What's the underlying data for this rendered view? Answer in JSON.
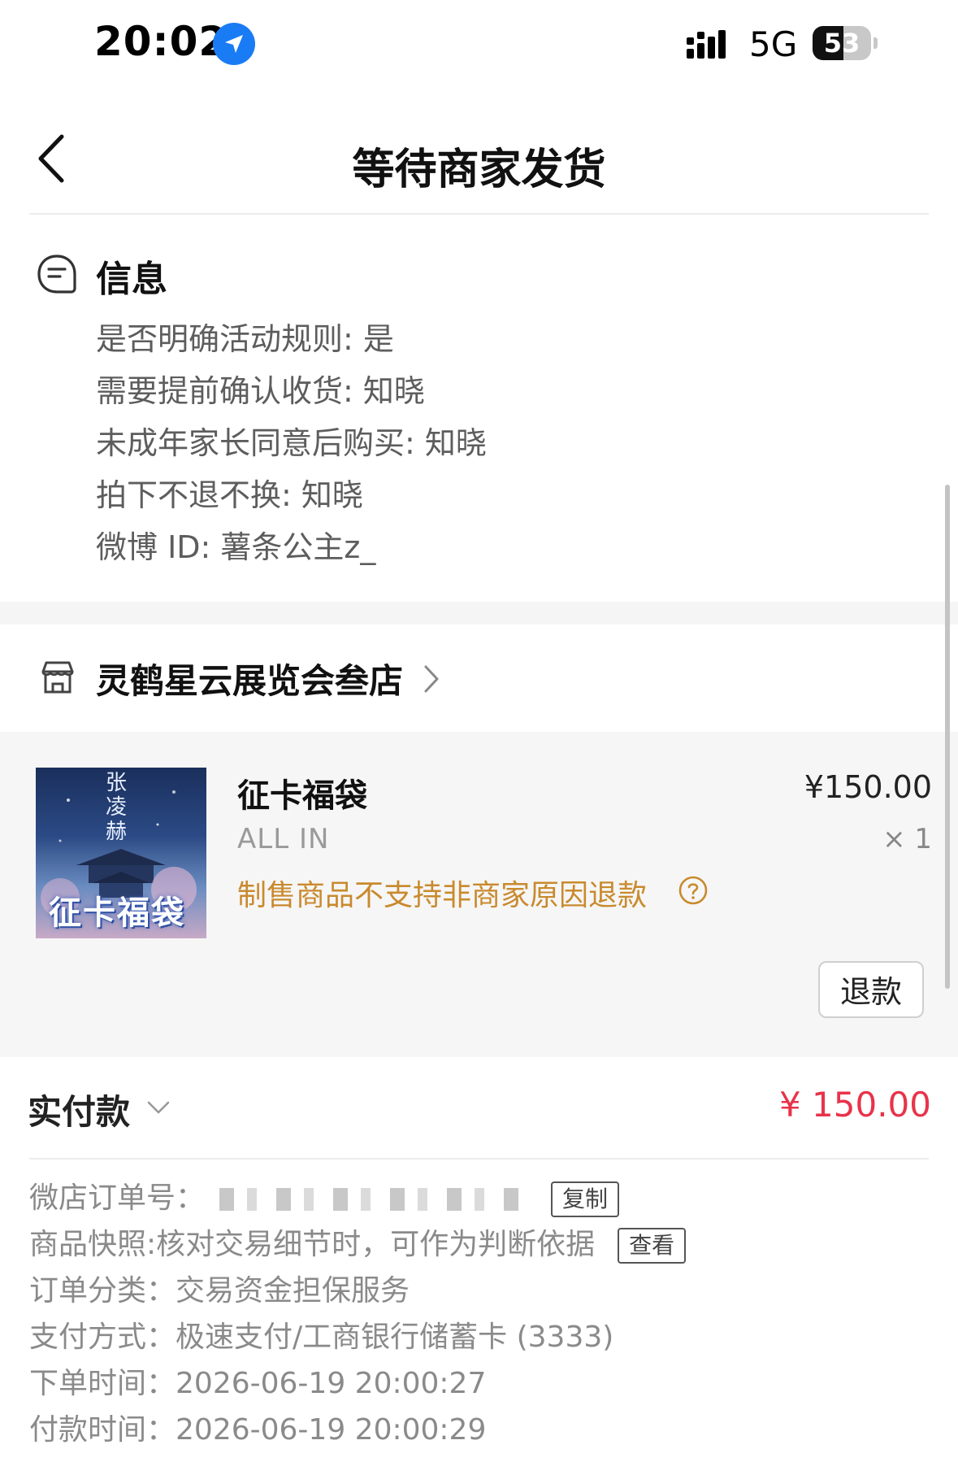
{
  "status_bar": {
    "time": "20:02",
    "network": "5G",
    "battery": "53",
    "battery_level_percent": 53
  },
  "nav": {
    "title": "等待商家发货"
  },
  "info": {
    "title": "信息",
    "lines": [
      "是否明确活动规则: 是",
      "需要提前确认收货: 知晓",
      "未成年家长同意后购买: 知晓",
      "拍下不退不换: 知晓",
      "微博 ID: 薯条公主z_"
    ]
  },
  "shop": {
    "name": "灵鹤星云展览会叁店"
  },
  "product": {
    "image_text_top": "张凌赫",
    "image_text_main": "征卡福袋",
    "name": "征卡福袋",
    "variant": "ALL IN",
    "refund_policy": "制售商品不支持非商家原因退款",
    "price": "¥150.00",
    "quantity": "× 1",
    "refund_button": "退款"
  },
  "payment": {
    "label": "实付款",
    "amount": "¥ 150.00",
    "amount_color": "#e8334a"
  },
  "details": {
    "order_no_label": "微店订单号：",
    "copy_button": "复制",
    "snapshot_label": "商品快照:",
    "snapshot_value": "核对交易细节时，可作为判断依据",
    "view_button": "查看",
    "category_label": "订单分类：",
    "category_value": "交易资金担保服务",
    "payment_method_label": "支付方式：",
    "payment_method_value": "极速支付/工商银行储蓄卡 (3333)",
    "order_time_label": "下单时间：",
    "order_time_value": "2026-06-19 20:00:27",
    "pay_time_label": "付款时间：",
    "pay_time_value": "2026-06-19 20:00:29"
  },
  "colors": {
    "accent_red": "#e8334a",
    "policy_orange": "#c98a2e",
    "location_blue": "#1a7cf5"
  }
}
